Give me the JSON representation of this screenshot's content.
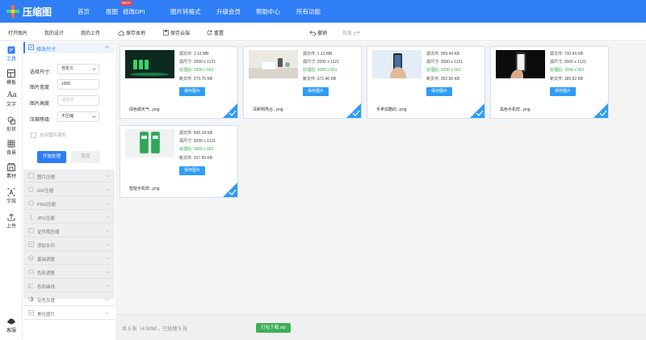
{
  "brand": {
    "name": "压缩图"
  },
  "nav": {
    "items": [
      "首页",
      "抠图",
      "修改DPI",
      "图片转格式",
      "升级会员",
      "帮助中心",
      "所有功能"
    ],
    "new_badge": "NEW"
  },
  "toolbar": {
    "open": "打开图片",
    "my_design": "我的设计",
    "my_upload": "我的上传",
    "save_local": "保存本地",
    "save_cloud": "保存云端",
    "reset": "重置",
    "undo": "撤销",
    "redo": "恢复"
  },
  "rail": {
    "items": [
      "工具",
      "模板",
      "文字",
      "形状",
      "背景",
      "素材",
      "字效",
      "上传"
    ],
    "service": "客服"
  },
  "panel": {
    "title": "修改尺寸",
    "size_label": "选择尺寸:",
    "size_value": "自定义",
    "width_label": "图片宽度",
    "width_value": "1000",
    "height_label": "图片高度",
    "height_placeholder": "请自动",
    "level_label": "压缩等级:",
    "level_value": "不压缩",
    "deform_label": "允许图片变形",
    "start_btn": "开始处理",
    "cancel_btn": "取消"
  },
  "tools": [
    "图片压缩",
    "GIF压缩",
    "PNG压缩",
    "JPG压缩",
    "证件照压缩",
    "添加水印",
    "基础调整",
    "色彩调整",
    "色彩曲线",
    "灰色灰度",
    "美化图片"
  ],
  "labels": {
    "src": "源文件:",
    "src_size": "源尺寸:",
    "after": "处理后:",
    "new": "新文件:",
    "save": "保存图片"
  },
  "cards": [
    {
      "src": "1.13 MB",
      "src_size": "2000 x 1121",
      "after": "1000 x 561",
      "new": "270.75 KB",
      "name": "绿色顺天气...png"
    },
    {
      "src": "1.12 MB",
      "src_size": "2000 x 1121",
      "after": "1000 x 561",
      "new": "372.40 KB",
      "name": "清新明亮台...png"
    },
    {
      "src": "999.44 KB",
      "src_size": "2000 x 1121",
      "after": "1000 x 561",
      "new": "262.56 KB",
      "name": "手拿炫酷的...png"
    },
    {
      "src": "700.94 KB",
      "src_size": "2000 x 1121",
      "after": "1000 x 561",
      "new": "185.52 KB",
      "name": "黑色手机样...png"
    },
    {
      "src": "606.18 KB",
      "src_size": "2000 x 1121",
      "after": "1000 x 561",
      "new": "157.99 KB",
      "name": "智能手机样...png"
    }
  ],
  "footer": {
    "summary": "共 5 张（4.50M），已处理 5 张",
    "zip": "打包下载.zip"
  },
  "colors": {
    "brand": "#2f7ef5",
    "green": "#2fae48",
    "save": "#2f9cf5",
    "zip": "#3dae58"
  }
}
